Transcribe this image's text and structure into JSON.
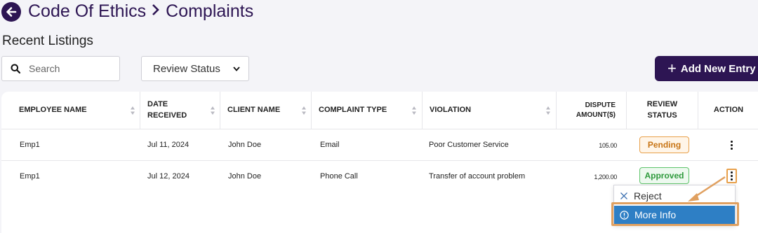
{
  "header": {
    "crumb_parent": "Code Of Ethics",
    "crumb_current": "Complaints"
  },
  "section_title": "Recent Listings",
  "search": {
    "placeholder": "Search"
  },
  "review_status_select": {
    "selected": "Review Status"
  },
  "add_button_label": "Add New Entry",
  "columns": [
    "EMPLOYEE NAME",
    "DATE RECEIVED",
    "CLIENT NAME",
    "COMPLAINT TYPE",
    "VIOLATION",
    "DISPUTE AMOUNT($)",
    "REVIEW STATUS",
    "ACTION"
  ],
  "column_lines": {
    "date_1": "DATE",
    "date_2": "RECEIVED",
    "dispute_1": "DISPUTE",
    "dispute_2": "AMOUNT($)",
    "review_1": "REVIEW",
    "review_2": "STATUS"
  },
  "rows": [
    {
      "employee": "Emp1",
      "date": "Jul 11, 2024",
      "client": "John Doe",
      "type": "Email",
      "violation": "Poor Customer Service",
      "amount": "105.00",
      "status": "Pending"
    },
    {
      "employee": "Emp1",
      "date": "Jul 12, 2024",
      "client": "John Doe",
      "type": "Phone Call",
      "violation": "Transfer of account problem",
      "amount": "1,200.00",
      "status": "Approved"
    }
  ],
  "action_menu": {
    "reject": "Reject",
    "more_info": "More Info"
  },
  "colors": {
    "brand": "#2d1553",
    "pending": "#c77414",
    "approved": "#2e9a3c",
    "menu_highlight": "#2e7fc5",
    "callout": "#e0a060"
  }
}
